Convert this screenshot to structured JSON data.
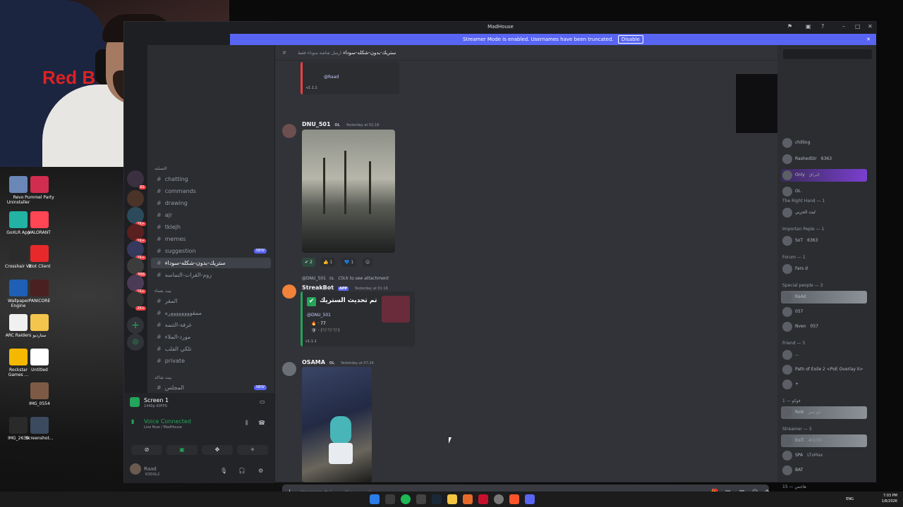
{
  "window": {
    "title": "MadHouse"
  },
  "banner": {
    "text": "Streamer Mode is enabled. Usernames have been truncated.",
    "button": "Disable"
  },
  "desktop_icons": [
    {
      "label": "Revo Uninstaller",
      "color": "#6a87b8"
    },
    {
      "label": "Pummel Party",
      "color": "#d12d4e"
    },
    {
      "label": "GoXLR App",
      "color": "#22b3a4"
    },
    {
      "label": "VALORANT",
      "color": "#ff4655"
    },
    {
      "label": "Crosshair V2",
      "color": "#2b2b2b"
    },
    {
      "label": "Riot Client",
      "color": "#e8292c"
    },
    {
      "label": "Wallpaper Engine",
      "color": "#1f5fb5"
    },
    {
      "label": "PANICORE",
      "color": "#4a2020"
    },
    {
      "label": "ARC Raiders",
      "color": "#f0f0f0"
    },
    {
      "label": "ستارديو",
      "color": "#f3c54d"
    },
    {
      "label": "Rockstar Games ...",
      "color": "#f5b800"
    },
    {
      "label": "Untitled",
      "color": "#ffffff"
    },
    {
      "label": "IMG_0554",
      "color": "#7d5a45"
    },
    {
      "label": "IMG_2630",
      "color": "#2a2a2a"
    },
    {
      "label": "Screenshot...",
      "color": "#3b4a5e"
    }
  ],
  "channels": {
    "category1": "التسليه",
    "items": [
      {
        "name": "chatting",
        "active": false,
        "new": false
      },
      {
        "name": "commands",
        "active": false,
        "new": false
      },
      {
        "name": "drawing",
        "active": false,
        "new": false
      },
      {
        "name": "ajr",
        "active": false,
        "new": false
      },
      {
        "name": "tklejh",
        "active": false,
        "new": false
      },
      {
        "name": "memes",
        "active": false,
        "new": false
      },
      {
        "name": "suggestion",
        "active": false,
        "new": true
      },
      {
        "name": "ستريك-بدون-شكله-سوداء",
        "active": true,
        "new": false
      },
      {
        "name": "زوم-القرات-النماسه",
        "active": false,
        "new": false
      }
    ],
    "category2": "بيت بعماء",
    "items2": [
      {
        "name": "المقر"
      },
      {
        "name": "ممقووووووووره"
      },
      {
        "name": "غرفة-التنمه"
      },
      {
        "name": "مورد-الملاء"
      },
      {
        "name": "تلكي الفلب"
      },
      {
        "name": "private"
      }
    ],
    "category3": "بيت شاكه",
    "items3": [
      {
        "name": "المجلس",
        "new": true
      }
    ],
    "new_label": "NEW"
  },
  "voice": {
    "screen_title": "Screen 1",
    "screen_sub": "1440p 60FPS",
    "connected": "Voice Connected",
    "connected_sub": "Live Now / MadHouse",
    "user": "Raad",
    "user_sub": "R3DUL2"
  },
  "chat": {
    "channel": "ستريك-بدون-شكله-سوداء",
    "topic": "ارسل شاشة سوداء فقط",
    "top_badge": "v1.1.1",
    "top_mention": "@Raad",
    "messages": [
      {
        "author": "DNU_501",
        "tag": "OL",
        "time": "Yesterday at 01:16"
      },
      {
        "reply_author": "@DNU_501",
        "reply_tag": "OL",
        "reply_text": "Click to see attachment",
        "author": "StreakBot",
        "app": "APP",
        "time": "Yesterday at 01:16"
      },
      {
        "author": "OSAMA",
        "tag": "OL",
        "time": "Yesterday at 07:24"
      }
    ],
    "reactions": [
      "2",
      "1",
      "1"
    ],
    "embed": {
      "title": "تم تحديث الستريك",
      "mention": "@DNU_501",
      "count": "77",
      "version": "v1.1.1"
    },
    "input_placeholder": "Message #ستريك-بدون-شكله-سوداء"
  },
  "members": {
    "rows_top": [
      {
        "name": "chilling"
      },
      {
        "name": "RashedStr",
        "badge": "6363"
      },
      {
        "name": "Only",
        "sub": "البراق"
      },
      {
        "name": "OL"
      }
    ],
    "groups": [
      {
        "title": "The Right Hand — 1",
        "rows": [
          {
            "name": "ليث الحربي"
          }
        ]
      },
      {
        "title": "Importan Peple — 1",
        "rows": [
          {
            "name": "SoT",
            "badge": "6363"
          }
        ]
      },
      {
        "title": "Forum — 1",
        "rows": [
          {
            "name": "Fars d"
          }
        ]
      },
      {
        "title": "Special people — 3",
        "rows": [
          {
            "name": "RaAd"
          },
          {
            "name": "057"
          },
          {
            "name": "Nven",
            "badge": "057"
          }
        ]
      },
      {
        "title": "Friend — 3",
        "rows": [
          {
            "name": "..."
          },
          {
            "name": "Path of Exile 2 <PoE Overlay II>"
          },
          {
            "name": "+"
          }
        ]
      },
      {
        "title": "1 — فوكو",
        "rows": [
          {
            "name": "RoN",
            "sub": "ابو ستر"
          }
        ]
      },
      {
        "title": "Streamer — 3",
        "rows": [
          {
            "name": "ExiT",
            "sub": "#G/00"
          },
          {
            "name": "SPA",
            "sub": "LTxMax"
          },
          {
            "name": "BAT"
          }
        ]
      },
      {
        "title": "15 — هاجس",
        "rows": []
      }
    ]
  },
  "taskbar": {
    "lang": "ENG",
    "time": "7:03 PM",
    "date": "1/6/2026"
  }
}
